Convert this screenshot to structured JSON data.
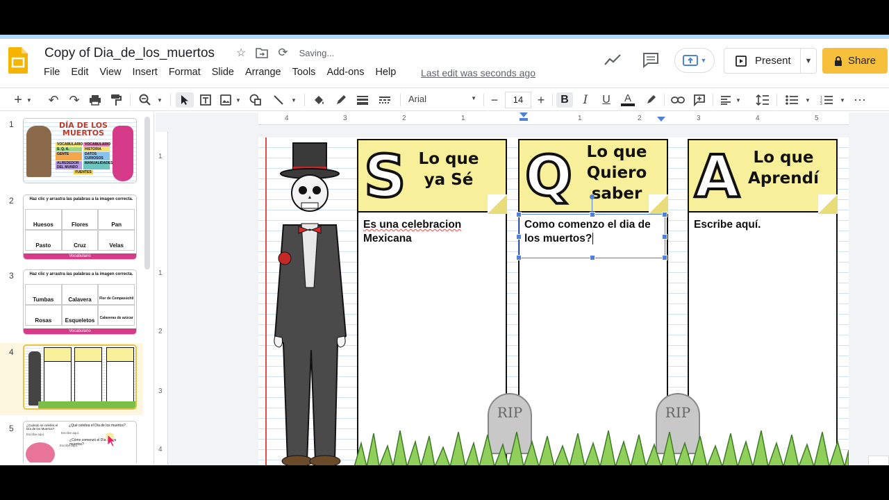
{
  "app": {
    "doc_title": "Copy of Dia_de_los_muertos",
    "save_status": "Saving...",
    "last_edit": "Last edit was seconds ago",
    "menus": [
      "File",
      "Edit",
      "View",
      "Insert",
      "Format",
      "Slide",
      "Arrange",
      "Tools",
      "Add-ons",
      "Help"
    ],
    "present_label": "Present",
    "share_label": "Share",
    "brand_color": "#f4b400",
    "share_color": "#f6c03c",
    "selection_color": "#4f81d8"
  },
  "toolbar": {
    "font_name": "Arial",
    "font_size": "14",
    "icons": [
      "add-icon",
      "undo-icon",
      "redo-icon",
      "print-icon",
      "paint-format-icon",
      "zoom-icon",
      "select-icon",
      "textbox-icon",
      "image-icon",
      "shape-icon",
      "line-icon",
      "fill-color-icon",
      "border-color-icon",
      "border-weight-icon",
      "border-dash-icon",
      "bold-icon",
      "italic-icon",
      "underline-icon",
      "text-color-icon",
      "highlight-icon",
      "link-icon",
      "comment-icon",
      "align-icon",
      "line-spacing-icon",
      "bulleted-list-icon",
      "numbered-list-icon",
      "more-icon"
    ]
  },
  "slides": [
    {
      "num": "1",
      "title_lines": [
        "DÍA DE LOS",
        "MUERTOS"
      ],
      "tags": [
        "VOCABULARIO",
        "VOCABULARIO",
        "S. Q. A.",
        "HISTORIA",
        "GENTE",
        "DATOS CURIOSOS",
        "ALREDEDOR DEL MUNDO",
        "MANUALIDADES",
        "FUENTES"
      ]
    },
    {
      "num": "2",
      "instruction": "Haz clic y arrastra las palabras a la imagen correcta.",
      "words": [
        "Huesos",
        "Flores",
        "Pan",
        "Pasto",
        "Cruz",
        "Velas"
      ],
      "footer": "Vocabulario"
    },
    {
      "num": "3",
      "instruction": "Haz clic y arrastra las palabras a la imagen correcta.",
      "words": [
        "Tumbas",
        "Calavera",
        "Flor de Cempasúchil",
        "Rosas",
        "Esqueletos",
        "Calaveras de azúcar"
      ],
      "footer": "Vocabulario"
    },
    {
      "num": "4"
    },
    {
      "num": "5",
      "q1": "¿Cuándo se celebra el Día de los Muertos?",
      "q2": "¿Qué celebra el Día de los muertos?",
      "q3": "¿Cómo comenzó el Día de los muertos?",
      "ans": "Escribe aquí."
    }
  ],
  "ruler": {
    "h_ticks": [
      "4",
      "3",
      "2",
      "1",
      "1",
      "2",
      "3",
      "4",
      "5"
    ],
    "v_ticks": [
      "1",
      "1",
      "2",
      "3",
      "4"
    ]
  },
  "slide": {
    "col_s": {
      "letter": "S",
      "heading_lines": [
        "Lo que",
        "ya Sé"
      ],
      "body_lines": [
        "Es una celebracion",
        "Mexicana"
      ]
    },
    "col_q": {
      "letter": "Q",
      "heading_lines": [
        "Lo que",
        "Quiero",
        "saber"
      ],
      "body_lines": [
        "Como comenzo el dia de",
        "los muertos?"
      ]
    },
    "col_a": {
      "letter": "A",
      "heading_lines": [
        "Lo que",
        "Aprendí"
      ],
      "body_lines": [
        "Escribe aquí."
      ]
    },
    "tombstone": "RIP"
  }
}
